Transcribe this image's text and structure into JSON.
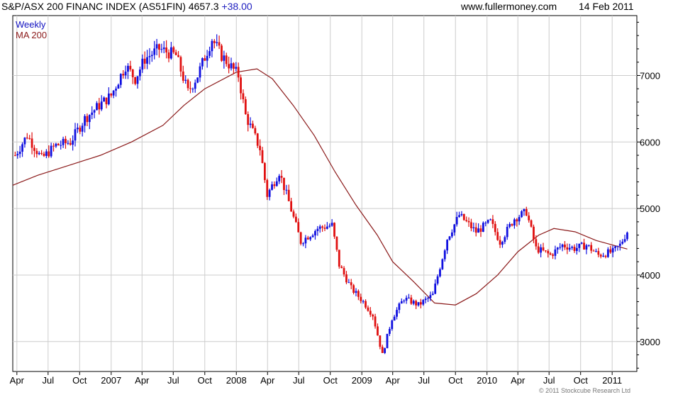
{
  "header": {
    "title": "S&P/ASX 200 FINANC INDEX (AS51FIN)",
    "last": "4657.3",
    "change": "+38.00",
    "site": "www.fullermoney.com",
    "date": "14 Feb 2011"
  },
  "copyright": "© 2011 Stockcube Research Ltd",
  "colors": {
    "up": "#1010e0",
    "down": "#e01010",
    "ma": "#8b1a1a",
    "grid": "#cccccc"
  },
  "chart_data": {
    "type": "candlestick",
    "title": "S&P/ASX 200 FINANC INDEX (AS51FIN)",
    "frequency_label": "Weekly",
    "legend": [
      {
        "name": "Weekly",
        "color": "#1010c0"
      },
      {
        "name": "MA 200",
        "color": "#8b1a1a"
      }
    ],
    "x_range": [
      "2006-03-20",
      "2011-03-14"
    ],
    "ylim": [
      2550,
      7900
    ],
    "y_ticks": [
      3000,
      4000,
      5000,
      6000,
      7000
    ],
    "y_axis_side": "right",
    "grid": true,
    "x_ticks": [
      {
        "label": "Apr",
        "date": "2006-04-01"
      },
      {
        "label": "Jul",
        "date": "2006-07-01"
      },
      {
        "label": "Oct",
        "date": "2006-10-01"
      },
      {
        "label": "2007",
        "date": "2007-01-01"
      },
      {
        "label": "Apr",
        "date": "2007-04-01"
      },
      {
        "label": "Jul",
        "date": "2007-07-01"
      },
      {
        "label": "Oct",
        "date": "2007-10-01"
      },
      {
        "label": "2008",
        "date": "2008-01-01"
      },
      {
        "label": "Apr",
        "date": "2008-04-01"
      },
      {
        "label": "Jul",
        "date": "2008-07-01"
      },
      {
        "label": "Oct",
        "date": "2008-10-01"
      },
      {
        "label": "2009",
        "date": "2009-01-01"
      },
      {
        "label": "Apr",
        "date": "2009-04-01"
      },
      {
        "label": "Jul",
        "date": "2009-07-01"
      },
      {
        "label": "Oct",
        "date": "2009-10-01"
      },
      {
        "label": "2010",
        "date": "2010-01-01"
      },
      {
        "label": "Apr",
        "date": "2010-04-01"
      },
      {
        "label": "Jul",
        "date": "2010-07-01"
      },
      {
        "label": "Oct",
        "date": "2010-10-01"
      },
      {
        "label": "2011",
        "date": "2011-01-01"
      }
    ],
    "weekly_close_path": [
      [
        "2006-03-27",
        5800
      ],
      [
        "2006-05-01",
        6100
      ],
      [
        "2006-06-12",
        5750
      ],
      [
        "2006-07-24",
        5950
      ],
      [
        "2006-09-04",
        6000
      ],
      [
        "2006-10-16",
        6350
      ],
      [
        "2006-11-27",
        6550
      ],
      [
        "2007-01-01",
        6700
      ],
      [
        "2007-02-12",
        7150
      ],
      [
        "2007-03-12",
        6950
      ],
      [
        "2007-04-09",
        7250
      ],
      [
        "2007-05-21",
        7400
      ],
      [
        "2007-07-09",
        7300
      ],
      [
        "2007-08-13",
        6750
      ],
      [
        "2007-09-10",
        7000
      ],
      [
        "2007-10-22",
        7550
      ],
      [
        "2007-11-19",
        7300
      ],
      [
        "2008-01-07",
        7000
      ],
      [
        "2008-01-28",
        6400
      ],
      [
        "2008-03-10",
        5900
      ],
      [
        "2008-03-31",
        5200
      ],
      [
        "2008-05-05",
        5550
      ],
      [
        "2008-06-02",
        5100
      ],
      [
        "2008-07-07",
        4500
      ],
      [
        "2008-08-25",
        4700
      ],
      [
        "2008-10-06",
        4750
      ],
      [
        "2008-10-27",
        4150
      ],
      [
        "2008-12-01",
        3800
      ],
      [
        "2009-01-05",
        3600
      ],
      [
        "2009-02-02",
        3400
      ],
      [
        "2009-03-02",
        2800
      ],
      [
        "2009-03-30",
        3350
      ],
      [
        "2009-05-04",
        3650
      ],
      [
        "2009-06-15",
        3550
      ],
      [
        "2009-07-27",
        3700
      ],
      [
        "2009-09-07",
        4550
      ],
      [
        "2009-10-12",
        4900
      ],
      [
        "2009-11-30",
        4650
      ],
      [
        "2010-01-11",
        4800
      ],
      [
        "2010-02-08",
        4500
      ],
      [
        "2010-03-22",
        4850
      ],
      [
        "2010-04-26",
        4950
      ],
      [
        "2010-05-24",
        4400
      ],
      [
        "2010-07-05",
        4300
      ],
      [
        "2010-08-09",
        4450
      ],
      [
        "2010-09-13",
        4400
      ],
      [
        "2010-10-18",
        4450
      ],
      [
        "2010-11-22",
        4300
      ],
      [
        "2011-01-03",
        4350
      ],
      [
        "2011-01-24",
        4450
      ],
      [
        "2011-02-14",
        4657
      ]
    ],
    "ma200_path": [
      [
        "2006-03-20",
        5350
      ],
      [
        "2006-06-01",
        5500
      ],
      [
        "2006-09-01",
        5650
      ],
      [
        "2006-12-01",
        5800
      ],
      [
        "2007-03-01",
        6000
      ],
      [
        "2007-06-01",
        6250
      ],
      [
        "2007-08-01",
        6550
      ],
      [
        "2007-10-01",
        6800
      ],
      [
        "2008-01-01",
        7050
      ],
      [
        "2008-03-01",
        7100
      ],
      [
        "2008-04-15",
        6950
      ],
      [
        "2008-06-15",
        6550
      ],
      [
        "2008-08-15",
        6100
      ],
      [
        "2008-10-15",
        5550
      ],
      [
        "2008-12-15",
        5050
      ],
      [
        "2009-02-15",
        4600
      ],
      [
        "2009-04-01",
        4200
      ],
      [
        "2009-06-01",
        3900
      ],
      [
        "2009-08-01",
        3580
      ],
      [
        "2009-10-01",
        3550
      ],
      [
        "2009-12-01",
        3720
      ],
      [
        "2010-02-01",
        4000
      ],
      [
        "2010-04-01",
        4350
      ],
      [
        "2010-06-01",
        4600
      ],
      [
        "2010-07-15",
        4700
      ],
      [
        "2010-09-15",
        4650
      ],
      [
        "2010-11-15",
        4520
      ],
      [
        "2011-02-14",
        4390
      ]
    ]
  }
}
